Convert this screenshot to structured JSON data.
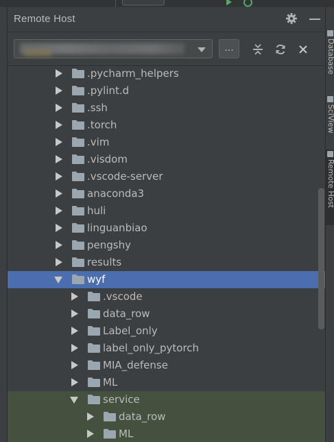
{
  "panel": {
    "title": "Remote Host",
    "ellipsis_label": "..."
  },
  "side_tabs": [
    {
      "label": "Database",
      "active": false
    },
    {
      "label": "SciView",
      "active": false
    },
    {
      "label": "Remote Host",
      "active": true
    }
  ],
  "tree": {
    "rows": [
      {
        "label": ".pycharm_helpers",
        "level": 0,
        "expanded": false,
        "state": "normal"
      },
      {
        "label": ".pylint.d",
        "level": 0,
        "expanded": false,
        "state": "normal"
      },
      {
        "label": ".ssh",
        "level": 0,
        "expanded": false,
        "state": "normal"
      },
      {
        "label": ".torch",
        "level": 0,
        "expanded": false,
        "state": "normal"
      },
      {
        "label": ".vim",
        "level": 0,
        "expanded": false,
        "state": "normal"
      },
      {
        "label": ".visdom",
        "level": 0,
        "expanded": false,
        "state": "normal"
      },
      {
        "label": ".vscode-server",
        "level": 0,
        "expanded": false,
        "state": "normal"
      },
      {
        "label": "anaconda3",
        "level": 0,
        "expanded": false,
        "state": "normal"
      },
      {
        "label": "huli",
        "level": 0,
        "expanded": false,
        "state": "normal"
      },
      {
        "label": "linguanbiao",
        "level": 0,
        "expanded": false,
        "state": "normal"
      },
      {
        "label": "pengshy",
        "level": 0,
        "expanded": false,
        "state": "normal"
      },
      {
        "label": "results",
        "level": 0,
        "expanded": false,
        "state": "normal"
      },
      {
        "label": "wyf",
        "level": 0,
        "expanded": true,
        "state": "selected"
      },
      {
        "label": ".vscode",
        "level": 1,
        "expanded": false,
        "state": "normal"
      },
      {
        "label": "data_row",
        "level": 1,
        "expanded": false,
        "state": "normal"
      },
      {
        "label": "Label_only",
        "level": 1,
        "expanded": false,
        "state": "normal"
      },
      {
        "label": "label_only_pytorch",
        "level": 1,
        "expanded": false,
        "state": "normal"
      },
      {
        "label": "MIA_defense",
        "level": 1,
        "expanded": false,
        "state": "normal"
      },
      {
        "label": "ML",
        "level": 1,
        "expanded": false,
        "state": "normal"
      },
      {
        "label": "service",
        "level": 1,
        "expanded": true,
        "state": "highlight"
      },
      {
        "label": "data_row",
        "level": 2,
        "expanded": false,
        "state": "highlight"
      },
      {
        "label": "ML",
        "level": 2,
        "expanded": false,
        "state": "highlight"
      }
    ]
  },
  "colors": {
    "background": "#3c3f41",
    "selection": "#4b6eaf",
    "highlight": "#44513f",
    "folder": "#9aa7b0",
    "text": "#bbbbbb"
  }
}
